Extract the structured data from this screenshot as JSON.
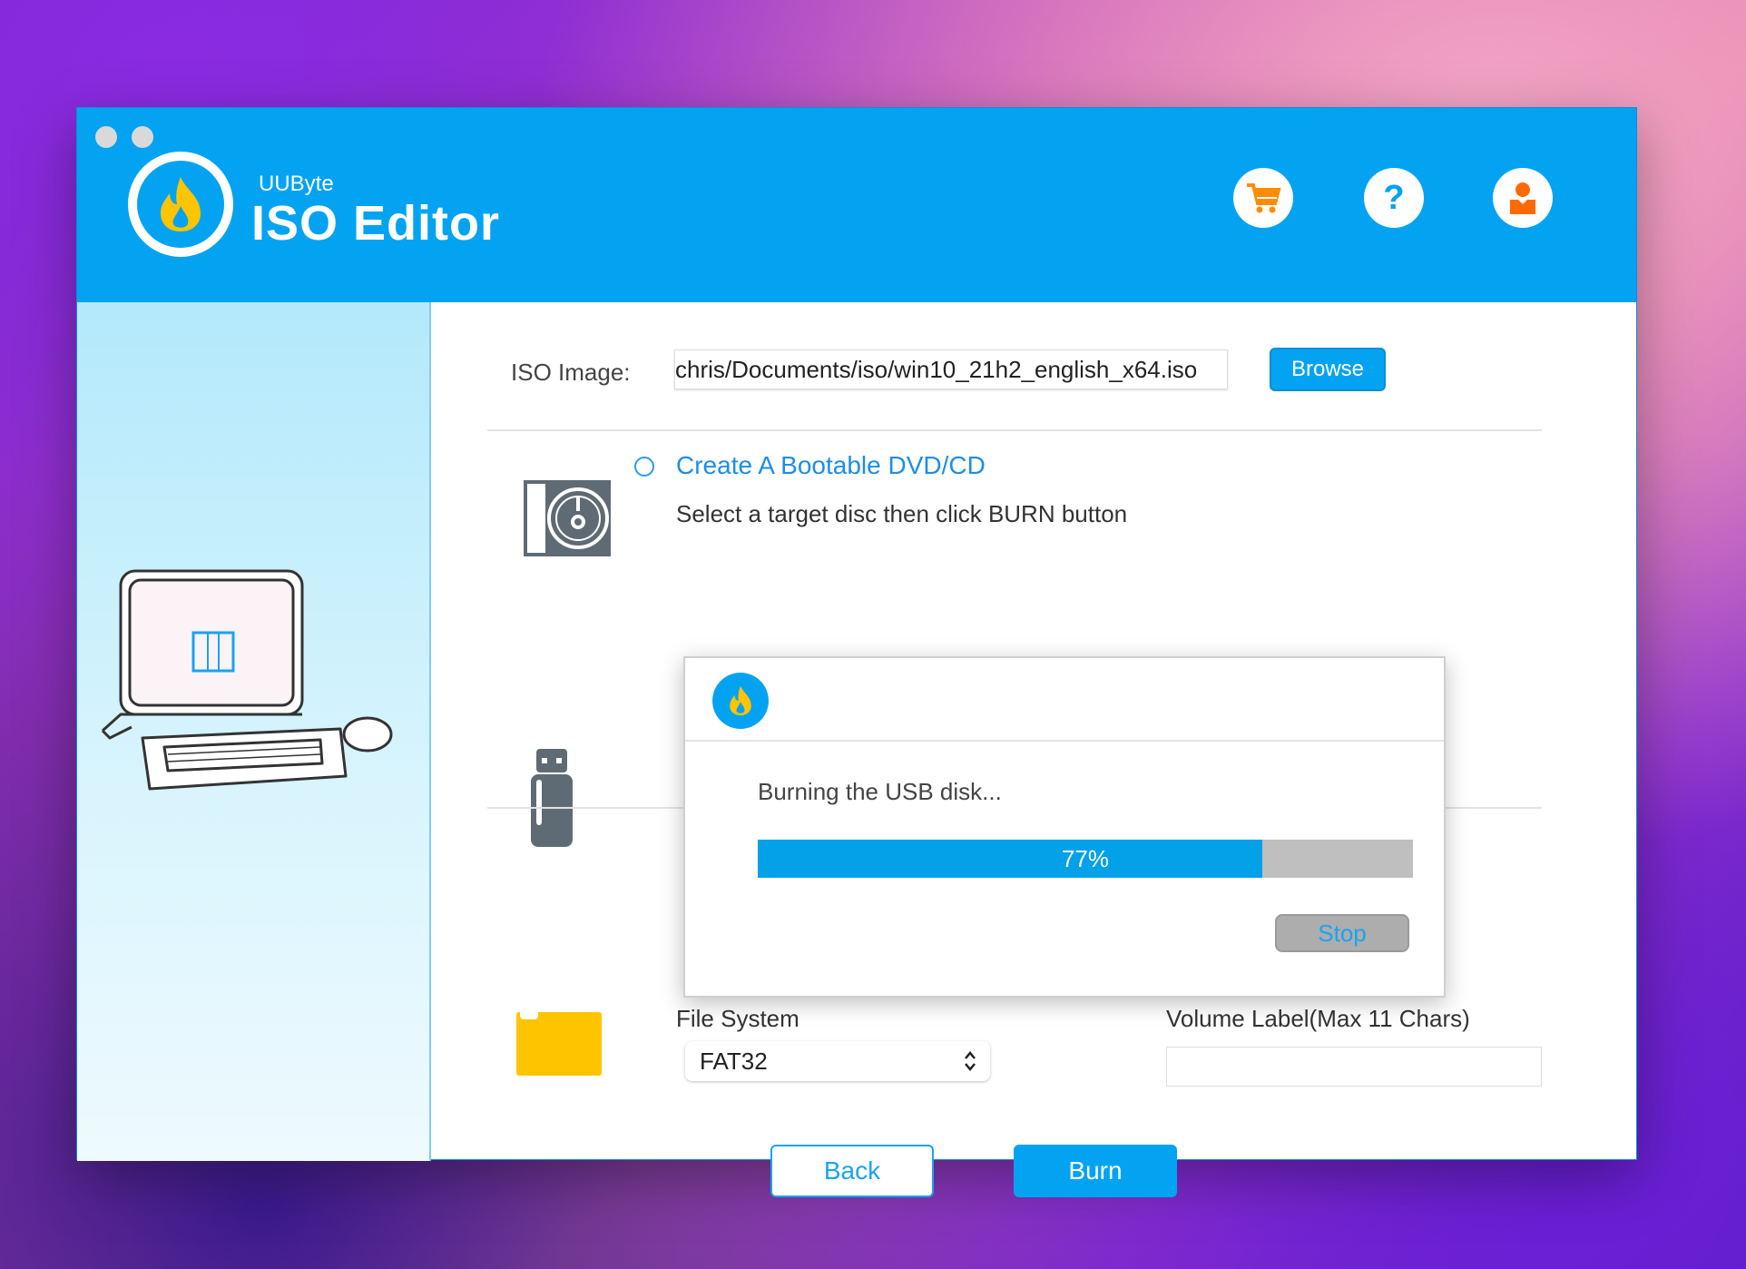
{
  "window": {
    "brand_small": "UUByte",
    "brand_title": "ISO Editor"
  },
  "header_icons": [
    {
      "name": "cart-icon",
      "color": "#ff8c00"
    },
    {
      "name": "help-icon",
      "color": "#03a3f2"
    },
    {
      "name": "user-icon",
      "color": "#ff6a00"
    }
  ],
  "iso": {
    "label": "ISO Image:",
    "value": "chris/Documents/iso/win10_21h2_english_x64.iso",
    "browse_label": "Browse"
  },
  "dvd": {
    "option_label": "Create A Bootable DVD/CD",
    "instruction": "Select a target disc then click BURN button",
    "selected": false
  },
  "filesystem": {
    "label": "File System",
    "selected": "FAT32"
  },
  "volume_label": {
    "label": "Volume Label(Max 11 Chars)",
    "value": ""
  },
  "actions": {
    "back_label": "Back",
    "burn_label": "Burn"
  },
  "dialog": {
    "message": "Burning the USB disk...",
    "progress_percent": 77,
    "progress_text": "77%",
    "stop_label": "Stop"
  },
  "colors": {
    "accent": "#03a3f2",
    "flame": "#ffc400"
  }
}
